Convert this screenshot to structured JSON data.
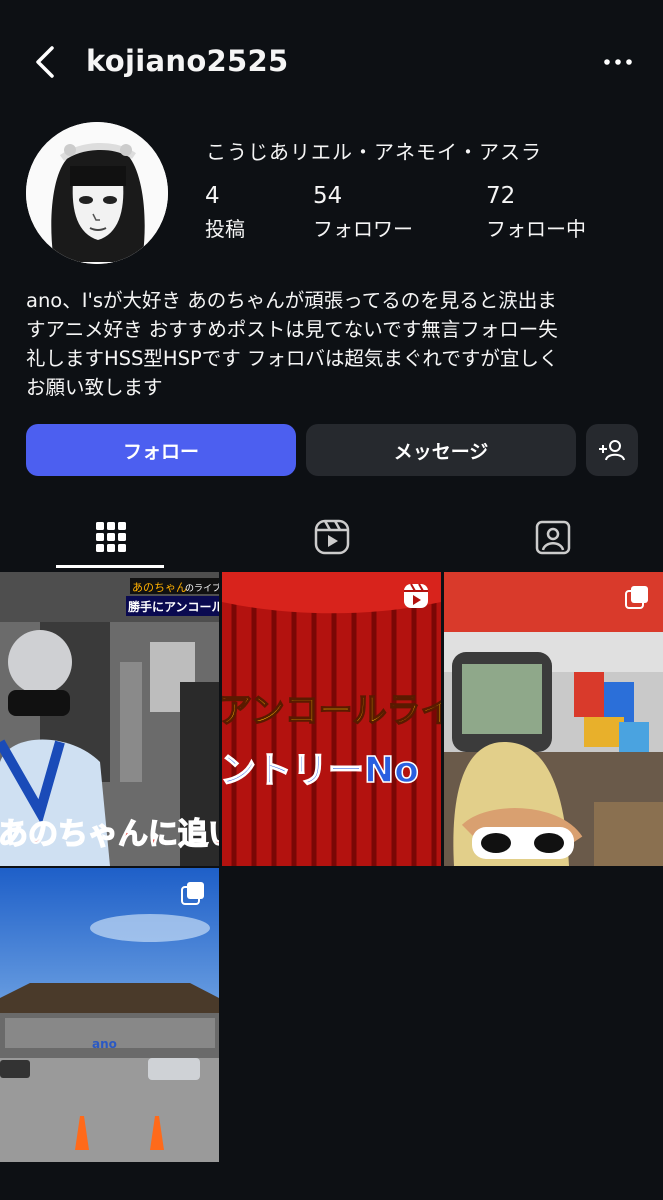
{
  "header": {
    "username": "kojiano2525",
    "back_icon": "chevron-left-icon",
    "more_icon": "more-horizontal-icon"
  },
  "profile": {
    "display_name": "こうじあリエル・アネモイ・アスラ",
    "stats": [
      {
        "value": "4",
        "label": "投稿"
      },
      {
        "value": "54",
        "label": "フォロワー"
      },
      {
        "value": "72",
        "label": "フォロー中"
      }
    ],
    "bio_lines": [
      "ano、I'sが大好き あのちゃんが頑張ってるのを見ると涙出ま",
      "すアニメ好き おすすめポストは見てないです無言フォロー失",
      "礼しますHSS型HSPです フォロバは超気まぐれですが宜しく",
      "お願い致します"
    ]
  },
  "actions": {
    "follow_label": "フォロー",
    "message_label": "メッセージ",
    "add_user_icon": "add-person-icon"
  },
  "tabs": [
    {
      "icon": "grid-icon",
      "selected": true
    },
    {
      "icon": "reels-icon",
      "selected": false
    },
    {
      "icon": "tagged-icon",
      "selected": false
    }
  ],
  "posts": [
    {
      "overlay_top1": "あのちゃん",
      "overlay_top2": "のライブ終",
      "overlay_top3": "勝手にアンコール",
      "caption": "あのちゃんに追い",
      "badge": "none"
    },
    {
      "caption1": "アンコールライ",
      "caption2": "ントリーNo",
      "badge": "reels-icon"
    },
    {
      "badge": "carousel-icon"
    },
    {
      "building_sign": "ano",
      "badge": "carousel-icon"
    }
  ],
  "colors": {
    "background": "#0d1014",
    "follow_button": "#4c5ff0",
    "secondary_button": "#26292e",
    "text": "#f5f5f5"
  }
}
